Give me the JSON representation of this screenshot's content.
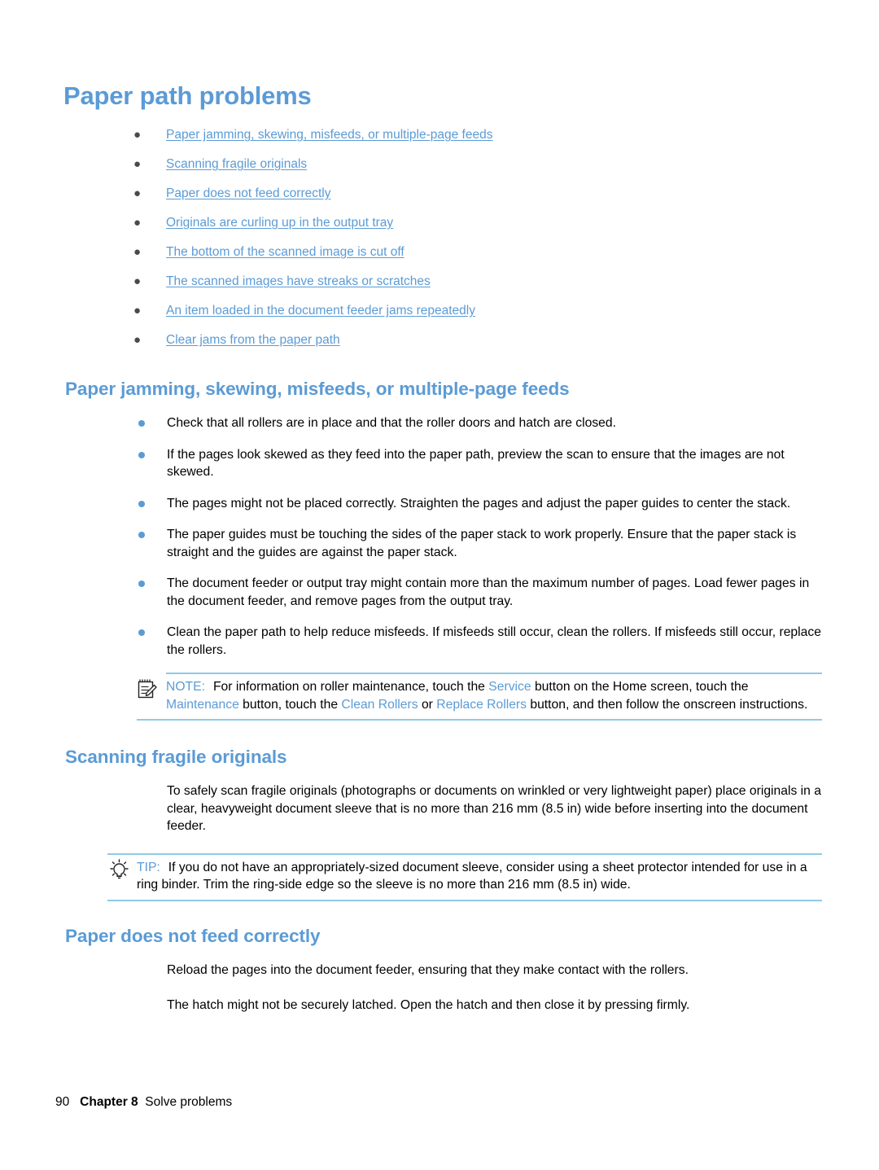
{
  "page": {
    "title": "Paper path problems",
    "footer": {
      "page_number": "90",
      "chapter": "Chapter 8",
      "chapter_title": "Solve problems"
    },
    "colors": {
      "heading_blue": "#5b9bd5",
      "link_blue": "#5b9bd5",
      "rule_blue": "#8ecae6",
      "bullet_blue": "#5b9bd5",
      "body_text": "#000000"
    }
  },
  "toc": {
    "bullet": "●",
    "items": [
      {
        "label": "Paper jamming, skewing, misfeeds, or multiple-page feeds"
      },
      {
        "label": "Scanning fragile originals"
      },
      {
        "label": "Paper does not feed correctly"
      },
      {
        "label": "Originals are curling up in the output tray"
      },
      {
        "label": "The bottom of the scanned image is cut off"
      },
      {
        "label": "The scanned images have streaks or scratches"
      },
      {
        "label": "An item loaded in the document feeder jams repeatedly"
      },
      {
        "label": "Clear jams from the paper path"
      }
    ]
  },
  "sections": {
    "jamming": {
      "heading": "Paper jamming, skewing, misfeeds, or multiple-page feeds",
      "bullets": [
        "Check that all rollers are in place and that the roller doors and hatch are closed.",
        "If the pages look skewed as they feed into the paper path, preview the scan to ensure that the images are not skewed.",
        "The pages might not be placed correctly. Straighten the pages and adjust the paper guides to center the stack.",
        "The paper guides must be touching the sides of the paper stack to work properly. Ensure that the paper stack is straight and the guides are against the paper stack.",
        "The document feeder or output tray might contain more than the maximum number of pages. Load fewer pages in the document feeder, and remove pages from the output tray.",
        "Clean the paper path to help reduce misfeeds. If misfeeds still occur, clean the rollers. If misfeeds still occur, replace the rollers."
      ],
      "note": {
        "icon": "note-icon",
        "label": "NOTE:",
        "text_1": "For information on roller maintenance, touch the ",
        "kw_1": "Service",
        "text_2": " button on the Home screen, touch the ",
        "kw_2": "Maintenance",
        "text_3": " button, touch the ",
        "kw_3": "Clean Rollers",
        "text_4": " or ",
        "kw_4": "Replace Rollers",
        "text_5": " button, and then follow the onscreen instructions."
      }
    },
    "fragile": {
      "heading": "Scanning fragile originals",
      "paragraph": "To safely scan fragile originals (photographs or documents on wrinkled or very lightweight paper) place originals in a clear, heavyweight document sleeve that is no more than 216 mm (8.5 in) wide before inserting into the document feeder.",
      "tip": {
        "icon": "lightbulb-icon",
        "label": "TIP:",
        "text": "If you do not have an appropriately-sized document sleeve, consider using a sheet protector intended for use in a ring binder. Trim the ring-side edge so the sleeve is no more than 216 mm (8.5 in) wide."
      }
    },
    "feed": {
      "heading": "Paper does not feed correctly",
      "paragraphs": [
        "Reload the pages into the document feeder, ensuring that they make contact with the rollers.",
        "The hatch might not be securely latched. Open the hatch and then close it by pressing firmly."
      ]
    }
  }
}
